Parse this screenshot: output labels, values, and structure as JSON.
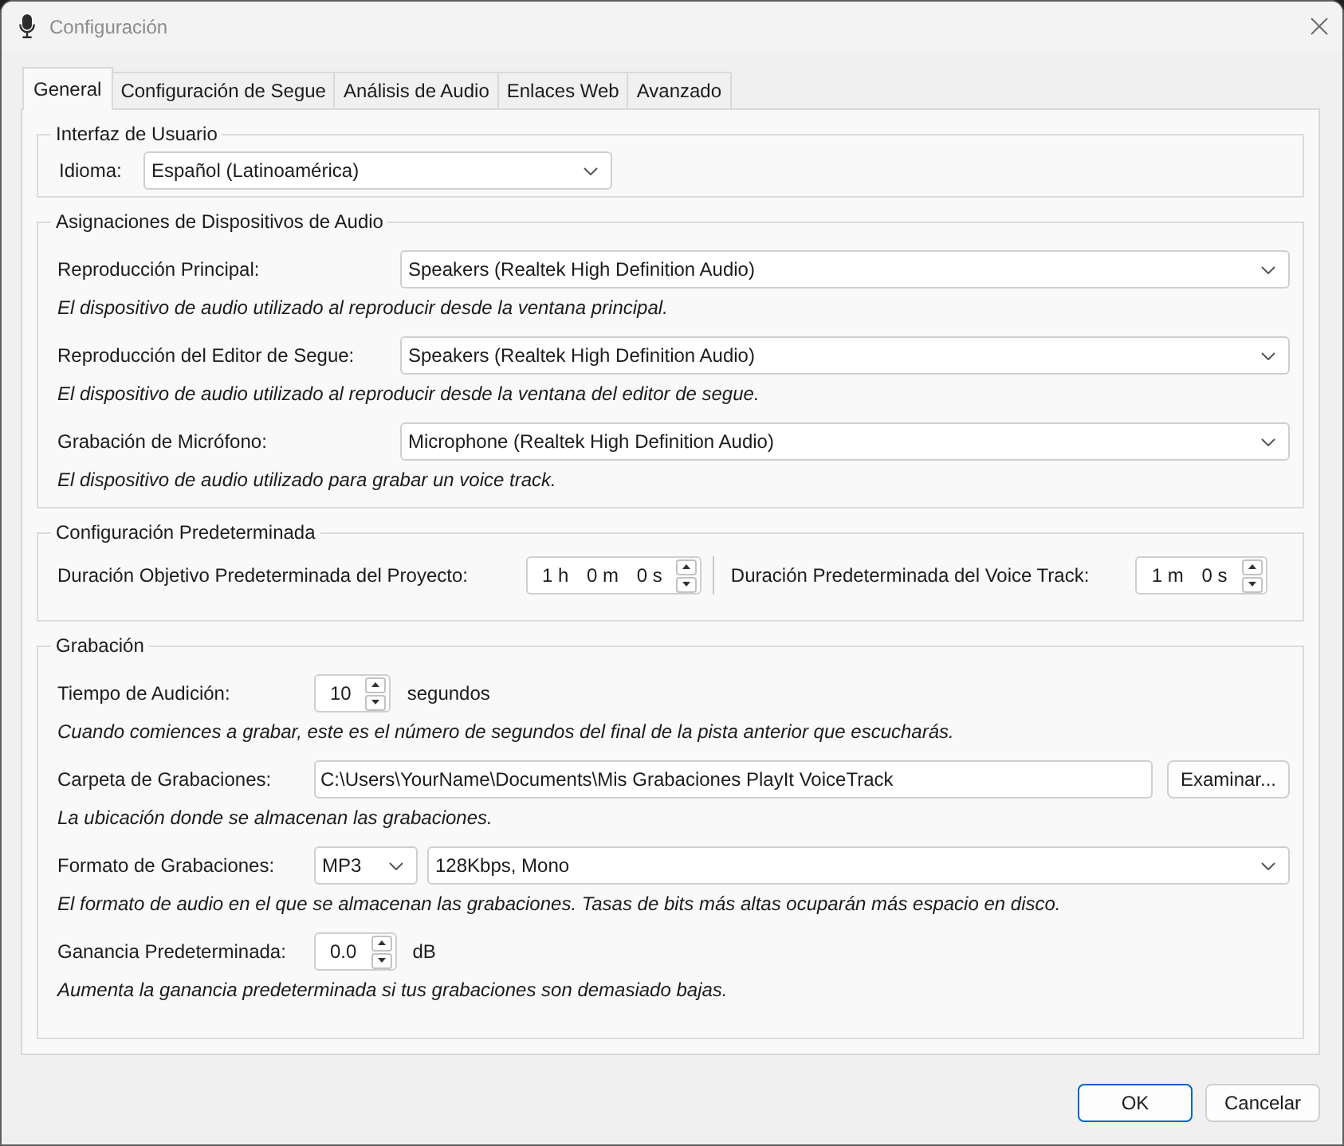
{
  "window": {
    "title": "Configuración"
  },
  "tabs": [
    {
      "label": "General",
      "selected": true
    },
    {
      "label": "Configuración de Segue",
      "selected": false
    },
    {
      "label": "Análisis de Audio",
      "selected": false
    },
    {
      "label": "Enlaces Web",
      "selected": false
    },
    {
      "label": "Avanzado",
      "selected": false
    }
  ],
  "groups": [
    {
      "title": "Interfaz de Usuario",
      "rows": [
        {
          "kind": "inline-dropdown",
          "label": "Idioma:",
          "value": "Español (Latinoamérica)"
        }
      ]
    },
    {
      "title": "Asignaciones de Dispositivos de Audio",
      "rows": [
        {
          "kind": "dropdown",
          "label": "Reproducción Principal:",
          "value": "Speakers (Realtek High Definition Audio)",
          "description": "El dispositivo de audio utilizado al reproducir desde la ventana principal."
        },
        {
          "kind": "dropdown",
          "label": "Reproducción del Editor de Segue:",
          "value": "Speakers (Realtek High Definition Audio)",
          "description": "El dispositivo de audio utilizado al reproducir desde la ventana del editor de segue."
        },
        {
          "kind": "dropdown",
          "label": "Grabación de Micrófono:",
          "value": "Microphone (Realtek High Definition Audio)",
          "description": "El dispositivo de audio utilizado para grabar un voice track."
        }
      ]
    },
    {
      "title": "Configuración Predeterminada",
      "rows": [
        {
          "kind": "durations",
          "fields": [
            {
              "label": "Duración Objetivo Predeterminada del Proyecto:",
              "parts": [
                "1 h",
                "0 m",
                "0 s"
              ]
            },
            {
              "label": "Duración Predeterminada del Voice Track:",
              "parts": [
                "1 m",
                "0 s"
              ]
            }
          ]
        }
      ]
    },
    {
      "title": "Grabación",
      "rows": [
        {
          "kind": "spinner",
          "label": "Tiempo de Audición:",
          "value": "10",
          "unit": "segundos",
          "description": "Cuando comiences a grabar, este es el número de segundos del final de la pista anterior que escucharás."
        },
        {
          "kind": "folder",
          "label": "Carpeta de Grabaciones:",
          "value": "C:\\Users\\YourName\\Documents\\Mis Grabaciones PlayIt VoiceTrack",
          "button": "Examinar...",
          "description": "La ubicación donde se almacenan las grabaciones."
        },
        {
          "kind": "format",
          "label": "Formato de Grabaciones:",
          "format": "MP3",
          "quality": "128Kbps, Mono",
          "description": "El formato de audio en el que se almacenan las grabaciones. Tasas de bits más altas ocuparán más espacio en disco."
        },
        {
          "kind": "spinner",
          "label": "Ganancia Predeterminada:",
          "value": "0.0",
          "unit": "dB",
          "description": "Aumenta la ganancia predeterminada si tus grabaciones son demasiado bajas."
        }
      ]
    }
  ],
  "buttons": [
    {
      "label": "OK",
      "default": true
    },
    {
      "label": "Cancelar",
      "default": false
    }
  ]
}
